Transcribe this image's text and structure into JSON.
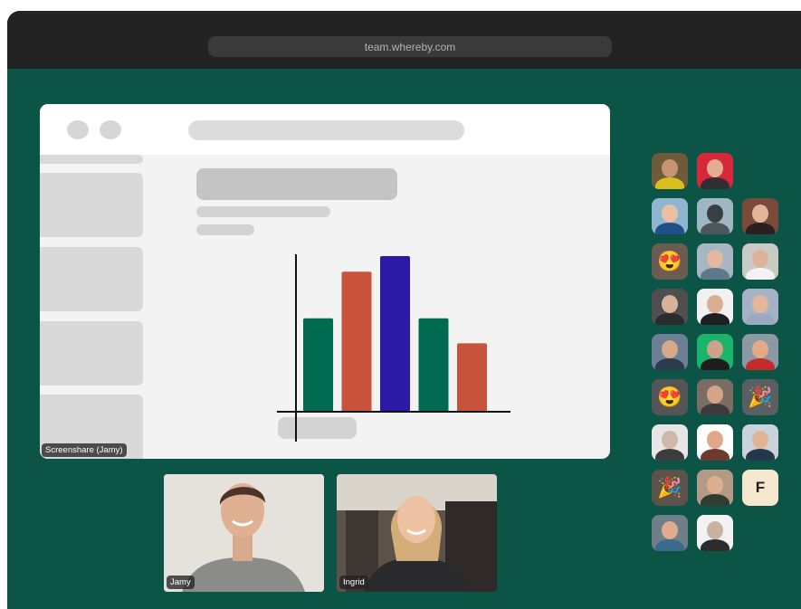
{
  "browser": {
    "url": "team.whereby.com"
  },
  "screenshare": {
    "label": "Screenshare (Jamy)",
    "chart_data": {
      "type": "bar",
      "categories": [
        "",
        "",
        "",
        "",
        ""
      ],
      "values": [
        60,
        90,
        100,
        60,
        44
      ],
      "colors": [
        "#006b51",
        "#c8523a",
        "#2b1aa3",
        "#006b51",
        "#c8523a"
      ],
      "title": "",
      "xlabel": "",
      "ylabel": "",
      "ylim": [
        0,
        100
      ],
      "grid": false
    }
  },
  "videos": [
    {
      "label": "Jamy"
    },
    {
      "label": "Ingrid"
    }
  ],
  "participants": [
    {
      "kind": "photo",
      "bg": "#6f5a3b",
      "skin": "#c69473",
      "shirt": "#d9c11d"
    },
    {
      "kind": "photo",
      "bg": "#d8263a",
      "skin": "#e2ad91",
      "shirt": "#2f2f33"
    },
    {
      "kind": "photo",
      "bg": "#8fb6d1",
      "skin": "#eac0a2",
      "shirt": "#214f8a"
    },
    {
      "kind": "photo",
      "bg": "#9fb6c4",
      "skin": "#3a3f43",
      "shirt": "#4d565a"
    },
    {
      "kind": "photo",
      "bg": "#7b4a3b",
      "skin": "#e4b49a",
      "shirt": "#2a2020"
    },
    {
      "kind": "emoji",
      "emoji": "😍",
      "bg": "#6a5c50"
    },
    {
      "kind": "photo",
      "bg": "#a6b6c2",
      "skin": "#e2b9a0",
      "shirt": "#5d7a8a"
    },
    {
      "kind": "photo",
      "bg": "#c9cbc4",
      "skin": "#dcb39a",
      "shirt": "#f2f2f2"
    },
    {
      "kind": "photo",
      "bg": "#4f4f4f",
      "skin": "#d7b39b",
      "shirt": "#2c2c2c"
    },
    {
      "kind": "photo",
      "bg": "#f1f1f1",
      "skin": "#d9ae93",
      "shirt": "#1f1f1f"
    },
    {
      "kind": "photo",
      "bg": "#a6b3c6",
      "skin": "#e3b79b",
      "shirt": "#9aa9bd"
    },
    {
      "kind": "photo",
      "bg": "#6d7f93",
      "skin": "#d6a98b",
      "shirt": "#2b3a4d"
    },
    {
      "kind": "photo",
      "bg": "#19b56b",
      "skin": "#cea28a",
      "shirt": "#1d1d1d"
    },
    {
      "kind": "photo",
      "bg": "#8b99a5",
      "skin": "#e3a987",
      "shirt": "#c42b2b"
    },
    {
      "kind": "emoji",
      "emoji": "😍",
      "bg": "#555555"
    },
    {
      "kind": "photo",
      "bg": "#7b6d64",
      "skin": "#d3a48a",
      "shirt": "#3b3b3b"
    },
    {
      "kind": "emoji",
      "emoji": "🎉",
      "bg": "#5a6062"
    },
    {
      "kind": "photo",
      "bg": "#e6e6e6",
      "skin": "#cfb8a8",
      "shirt": "#3c3c3c"
    },
    {
      "kind": "photo",
      "bg": "#ffffff",
      "skin": "#e0a789",
      "shirt": "#6b3b2d"
    },
    {
      "kind": "photo",
      "bg": "#c9d3dc",
      "skin": "#e2b496",
      "shirt": "#25364d"
    },
    {
      "kind": "emoji",
      "emoji": "🎉",
      "bg": "#5c534b"
    },
    {
      "kind": "photo",
      "bg": "#b39a86",
      "skin": "#dcb08f",
      "shirt": "#2f3c2f"
    },
    {
      "kind": "initial",
      "initial": "F",
      "bg": "#f6e7cf"
    },
    {
      "kind": "photo",
      "bg": "#6e7f8a",
      "skin": "#e0ac90",
      "shirt": "#3a6a8c"
    },
    {
      "kind": "photo",
      "bg": "#f2f2f2",
      "skin": "#c8b2a2",
      "shirt": "#2b2b2b"
    }
  ]
}
